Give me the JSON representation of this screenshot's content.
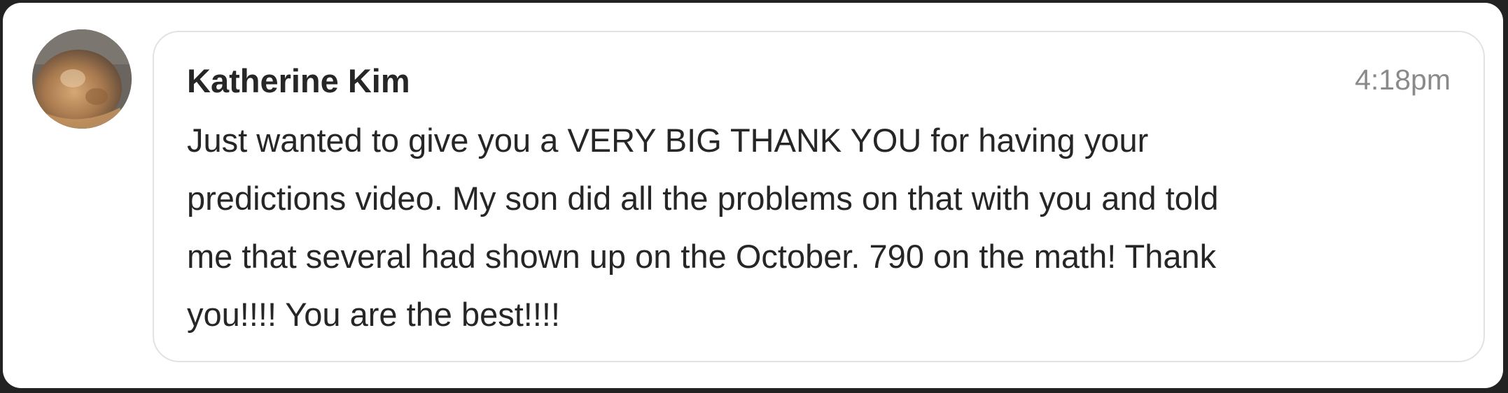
{
  "comment": {
    "author": "Katherine Kim",
    "time": "4:18pm",
    "avatar_icon": "user-photo-avatar",
    "message_lines": [
      "Just wanted to give you a VERY BIG THANK YOU for having your",
      "predictions video. My son did all the problems on that with you and told",
      "me that several had shown up on the October. 790 on the math! Thank",
      "you!!!! You are the best!!!!"
    ]
  }
}
